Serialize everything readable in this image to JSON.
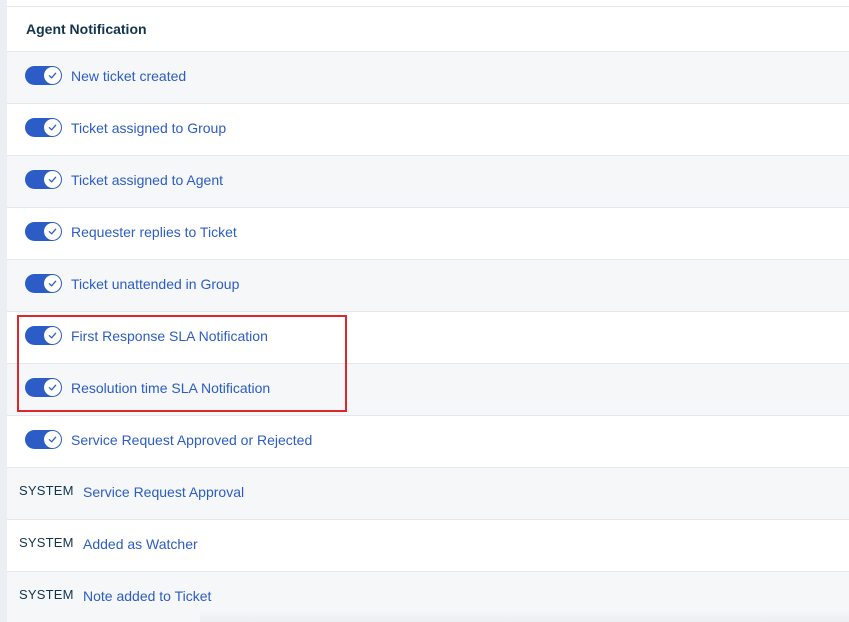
{
  "section": {
    "title": "Agent Notification"
  },
  "rows": [
    {
      "label": "New ticket created",
      "enabled": true
    },
    {
      "label": "Ticket assigned to Group",
      "enabled": true
    },
    {
      "label": "Ticket assigned to Agent",
      "enabled": true
    },
    {
      "label": "Requester replies to Ticket",
      "enabled": true
    },
    {
      "label": "Ticket unattended in Group",
      "enabled": true
    },
    {
      "label": "First Response SLA Notification",
      "enabled": true
    },
    {
      "label": "Resolution time SLA Notification",
      "enabled": true
    },
    {
      "label": "Service Request Approved or Rejected",
      "enabled": true
    }
  ],
  "system_rows": [
    {
      "tag": "SYSTEM",
      "label": "Service Request Approval"
    },
    {
      "tag": "SYSTEM",
      "label": "Added as Watcher"
    },
    {
      "tag": "SYSTEM",
      "label": "Note added to Ticket"
    }
  ],
  "colors": {
    "accent": "#2c5cc5",
    "highlight": "#e0262a",
    "heading": "#12344d"
  },
  "icons": {
    "toggle_knob": "check-icon"
  }
}
